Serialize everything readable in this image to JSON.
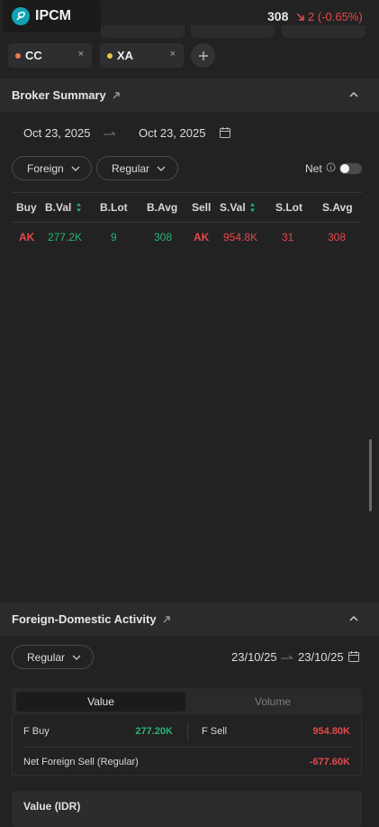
{
  "header": {
    "ticker": "IPCM",
    "price": "308",
    "change": "2 (-0.65%)"
  },
  "chips": [
    {
      "label": "CC",
      "color": "#e9795a"
    },
    {
      "label": "XA",
      "color": "#e6c64a"
    }
  ],
  "close_glyph": "×",
  "broker_summary": {
    "title": "Broker Summary",
    "date_from": "Oct 23, 2025",
    "date_to": "Oct 23, 2025",
    "filter_market": "Foreign",
    "filter_board": "Regular",
    "net_label": "Net",
    "net_toggle_on": false,
    "columns": [
      "Buy",
      "B.Val",
      "B.Lot",
      "B.Avg",
      "Sell",
      "S.Val",
      "S.Lot",
      "S.Avg"
    ],
    "rows": [
      {
        "buy": "AK",
        "bval": "277.2K",
        "blot": "9",
        "bavg": "308",
        "sell": "AK",
        "sval": "954.8K",
        "slot": "31",
        "savg": "308"
      }
    ]
  },
  "foreign_domestic": {
    "title": "Foreign-Domestic Activity",
    "filter_board": "Regular",
    "date_from": "23/10/25",
    "date_to": "23/10/25",
    "tabs": [
      "Value",
      "Volume"
    ],
    "active_tab": "Value",
    "f_buy_label": "F Buy",
    "f_buy_value": "277.20K",
    "f_sell_label": "F Sell",
    "f_sell_value": "954.80K",
    "net_label": "Net Foreign Sell (Regular)",
    "net_value": "-677.60K",
    "value_card_title": "Value (IDR)"
  },
  "colors": {
    "up": "#29b374",
    "down": "#e5484d",
    "logo": "#11a3b4"
  }
}
